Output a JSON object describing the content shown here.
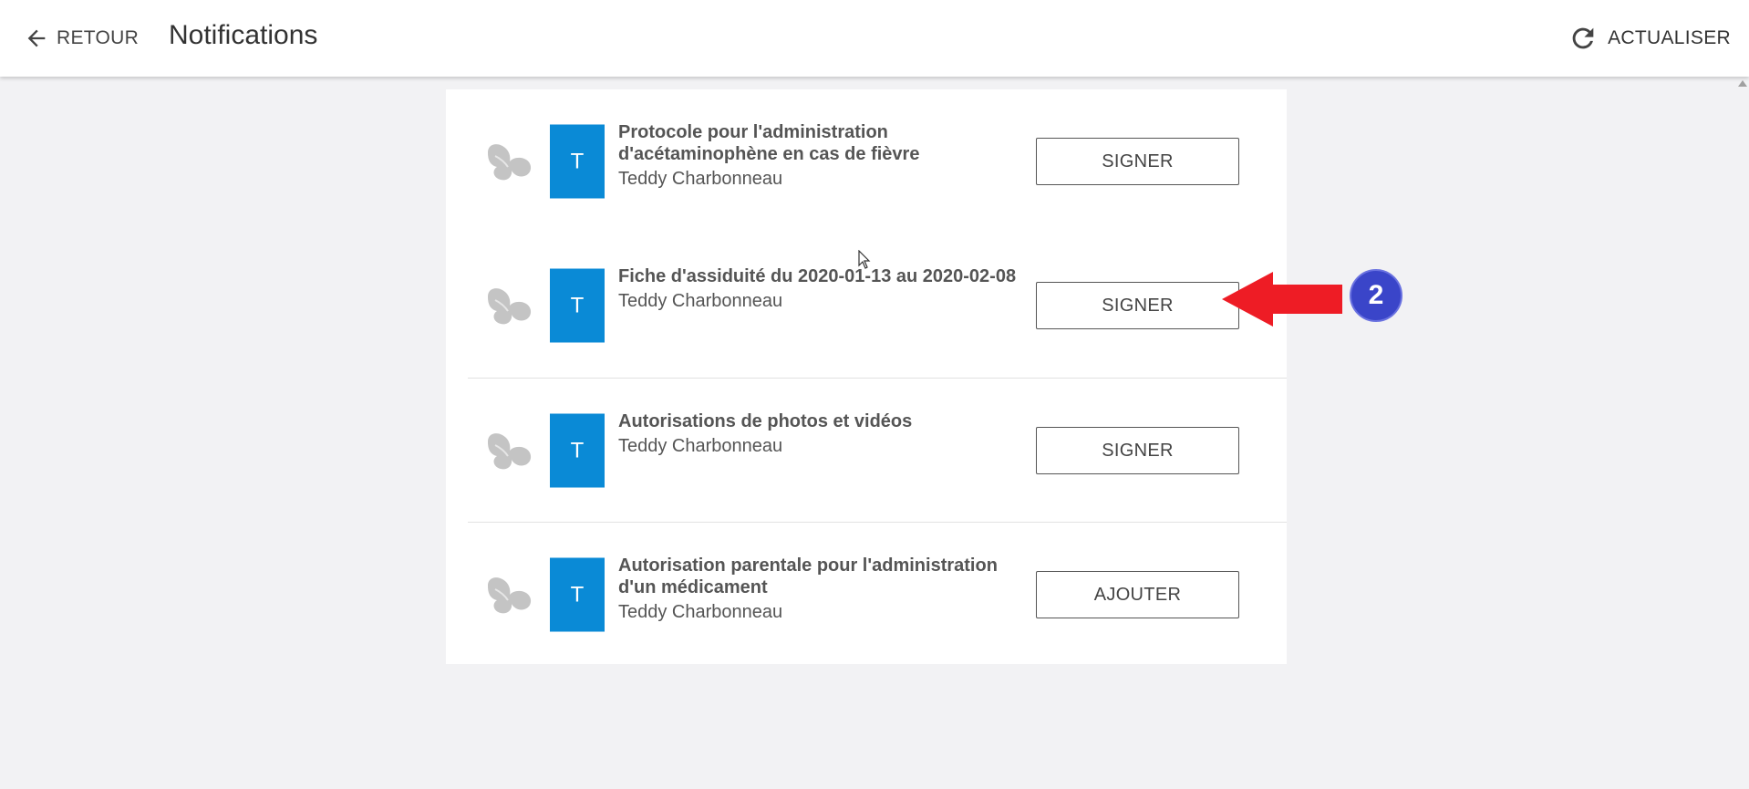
{
  "header": {
    "back_label": "RETOUR",
    "title": "Notifications",
    "refresh_label": "ACTUALISER"
  },
  "notifications": [
    {
      "avatar_letter": "T",
      "title": "Protocole pour l'administration d'acétaminophène en cas de fièvre",
      "author": "Teddy Charbonneau",
      "action": "SIGNER",
      "icon": "butterfly-icon"
    },
    {
      "avatar_letter": "T",
      "title": "Fiche d'assiduité du 2020-01-13 au 2020-02-08",
      "author": "Teddy Charbonneau",
      "action": "SIGNER",
      "icon": "butterfly-icon"
    },
    {
      "avatar_letter": "T",
      "title": "Autorisations de photos et vidéos",
      "author": "Teddy Charbonneau",
      "action": "SIGNER",
      "icon": "butterfly-icon"
    },
    {
      "avatar_letter": "T",
      "title": "Autorisation parentale pour l'administration d'un médicament",
      "author": "Teddy Charbonneau",
      "action": "AJOUTER",
      "icon": "butterfly-icon"
    }
  ],
  "annotation": {
    "step_number": "2"
  },
  "colors": {
    "avatar": "#0a8ad6",
    "arrow": "#ee1c25",
    "badge": "#3a45c9",
    "background": "#f2f2f4"
  }
}
